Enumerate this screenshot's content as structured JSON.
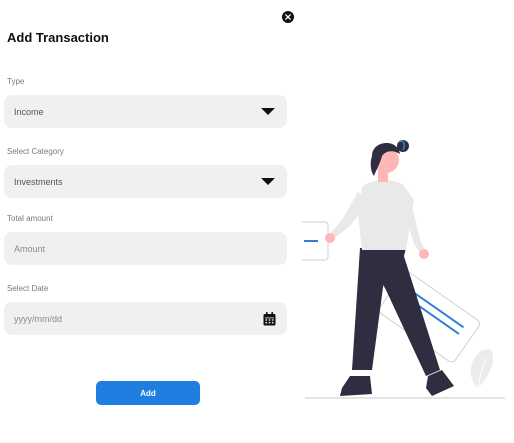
{
  "dialog": {
    "title": "Add Transaction",
    "close_icon": "close-icon"
  },
  "form": {
    "type": {
      "label": "Type",
      "value": "Income",
      "icon": "chevron-down-icon"
    },
    "category": {
      "label": "Select Category",
      "value": "Investments",
      "icon": "chevron-down-icon"
    },
    "amount": {
      "label": "Total amount",
      "placeholder": "Amount"
    },
    "date": {
      "label": "Select Date",
      "placeholder": "yyyy/mm/dd",
      "icon": "calendar-icon"
    },
    "submit_label": "Add"
  },
  "colors": {
    "accent": "#1e7fe0",
    "field_bg": "#eef0f2",
    "illustration_accent": "#2f80d6"
  }
}
